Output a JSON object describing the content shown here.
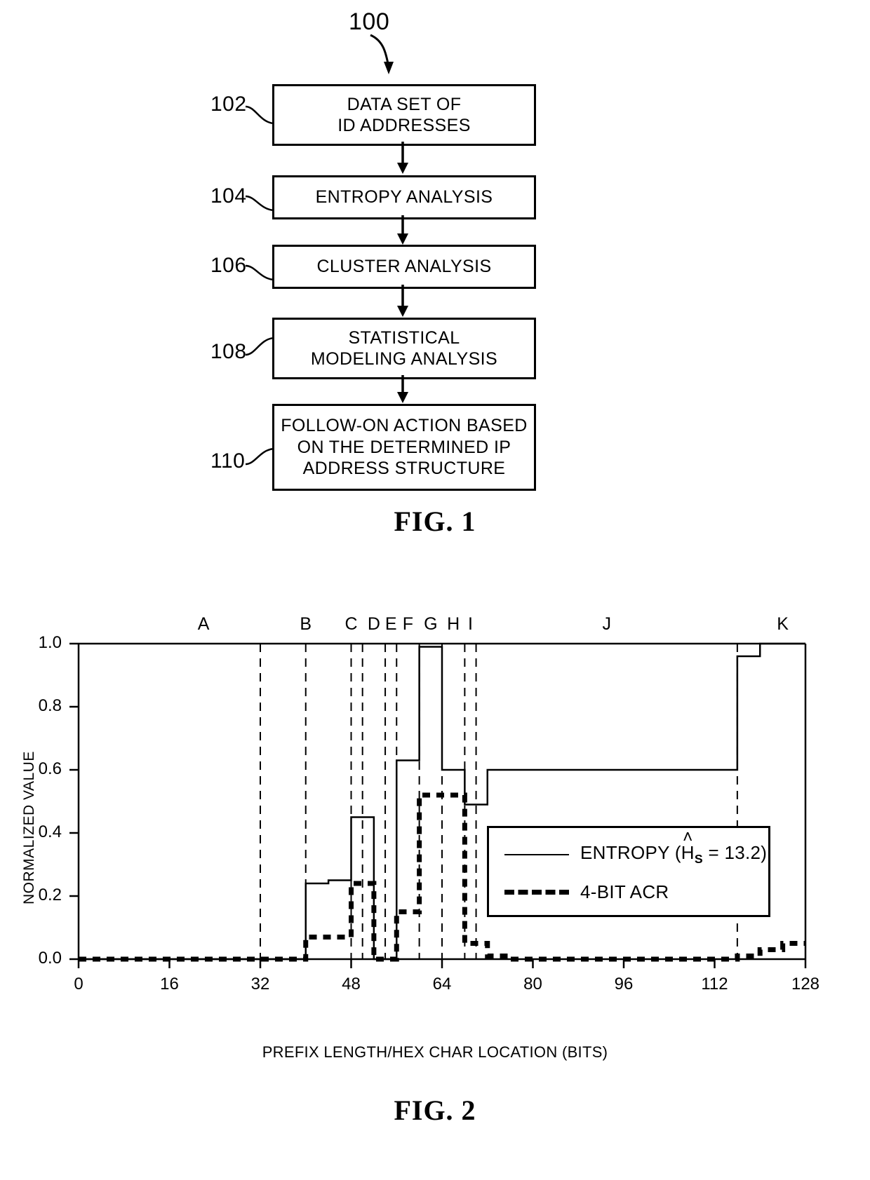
{
  "figure1": {
    "caption": "FIG. 1",
    "diagram_ref": "100",
    "steps": [
      {
        "ref": "102",
        "lines": [
          "DATA SET OF",
          "ID ADDRESSES"
        ]
      },
      {
        "ref": "104",
        "lines": [
          "ENTROPY ANALYSIS"
        ]
      },
      {
        "ref": "106",
        "lines": [
          "CLUSTER ANALYSIS"
        ]
      },
      {
        "ref": "108",
        "lines": [
          "STATISTICAL",
          "MODELING ANALYSIS"
        ]
      },
      {
        "ref": "110",
        "lines": [
          "FOLLOW-ON ACTION BASED",
          "ON THE DETERMINED IP",
          "ADDRESS STRUCTURE"
        ]
      }
    ]
  },
  "figure2": {
    "caption": "FIG. 2",
    "legend": {
      "entropy_prefix": "ENTROPY (",
      "entropy_symbol": "H",
      "entropy_hat": "˄",
      "entropy_subscript": "S",
      "entropy_value": " = 13.2)",
      "acr_label": "4-BIT ACR"
    }
  },
  "chart_data": {
    "type": "line",
    "title": "",
    "xlabel": "PREFIX LENGTH/HEX CHAR LOCATION (BITS)",
    "ylabel": "NORMALIZED VALUE",
    "xlim": [
      0,
      128
    ],
    "ylim": [
      0.0,
      1.0
    ],
    "xticks": [
      0,
      16,
      32,
      48,
      64,
      80,
      96,
      112,
      128
    ],
    "xtick_labels": [
      "0",
      "16",
      "32",
      "48",
      "64",
      "80",
      "96",
      "112",
      "128"
    ],
    "yticks": [
      0.0,
      0.2,
      0.4,
      0.6,
      0.8,
      1.0
    ],
    "ytick_labels": [
      "0.0",
      "0.2",
      "0.4",
      "0.6",
      "0.8",
      "1.0"
    ],
    "grid": false,
    "legend_position": "center-right",
    "cluster_boundaries": [
      32,
      40,
      48,
      50,
      54,
      56,
      60,
      64,
      68,
      70,
      116
    ],
    "cluster_labels": [
      "A",
      "B",
      "C",
      "D",
      "E",
      "F",
      "G",
      "H",
      "I",
      "J",
      "K"
    ],
    "cluster_label_x": [
      22,
      40,
      48,
      52,
      55,
      58,
      62,
      66,
      69,
      93,
      124
    ],
    "series": [
      {
        "name": "ENTROPY (ĤS = 13.2)",
        "style": "solid",
        "step": "post",
        "x": [
          0,
          4,
          8,
          12,
          16,
          20,
          24,
          28,
          32,
          36,
          40,
          44,
          48,
          52,
          56,
          60,
          64,
          68,
          72,
          76,
          80,
          84,
          88,
          92,
          96,
          100,
          104,
          108,
          112,
          116,
          120,
          124,
          128
        ],
        "y": [
          0.0,
          0.0,
          0.0,
          0.0,
          0.0,
          0.0,
          0.0,
          0.0,
          0.0,
          0.0,
          0.24,
          0.25,
          0.45,
          0.0,
          0.63,
          0.99,
          0.6,
          0.49,
          0.6,
          0.6,
          0.6,
          0.6,
          0.6,
          0.6,
          0.6,
          0.6,
          0.6,
          0.6,
          0.6,
          0.96,
          1.0,
          1.0,
          1.0
        ]
      },
      {
        "name": "4-BIT ACR",
        "style": "dashed",
        "step": "post",
        "x": [
          0,
          4,
          8,
          12,
          16,
          20,
          24,
          28,
          32,
          36,
          40,
          44,
          48,
          52,
          56,
          60,
          64,
          68,
          72,
          76,
          80,
          84,
          88,
          92,
          96,
          100,
          104,
          108,
          112,
          116,
          120,
          124,
          128
        ],
        "y": [
          0.0,
          0.0,
          0.0,
          0.0,
          0.0,
          0.0,
          0.0,
          0.0,
          0.0,
          0.0,
          0.07,
          0.07,
          0.24,
          0.0,
          0.15,
          0.52,
          0.52,
          0.05,
          0.01,
          0.0,
          0.0,
          0.0,
          0.0,
          0.0,
          0.0,
          0.0,
          0.0,
          0.0,
          0.0,
          0.01,
          0.03,
          0.05,
          0.05
        ]
      }
    ]
  }
}
